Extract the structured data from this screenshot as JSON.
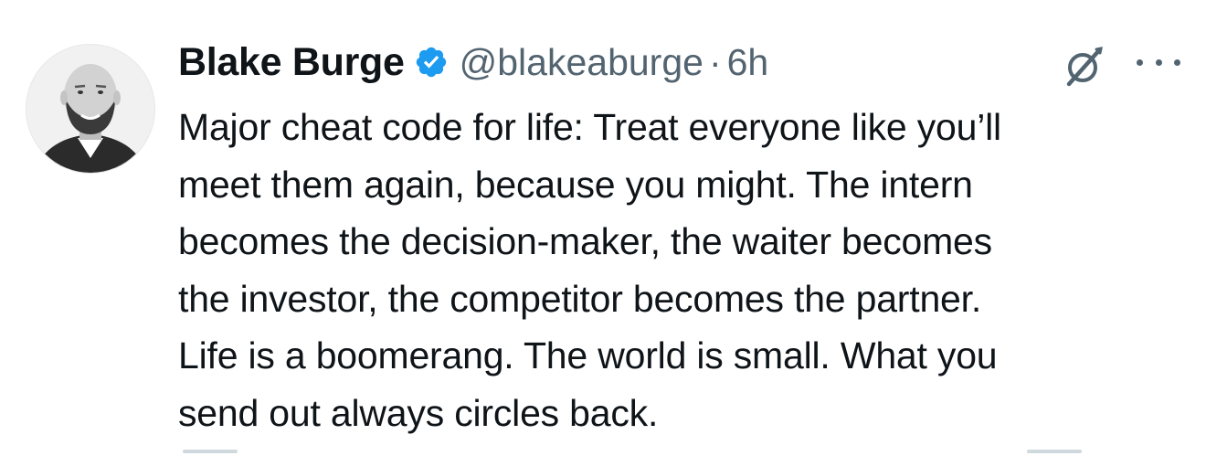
{
  "author": {
    "name": "Blake Burge",
    "handle": "@blakeaburge",
    "separator": "·",
    "time": "6h",
    "verified": true
  },
  "tweet": {
    "text": "Major cheat code for life: Treat everyone like you’ll\nmeet them again, because you might. The intern\nbecomes the decision-maker, the waiter becomes\nthe investor, the competitor becomes the partner.\nLife is a boomerang. The world is small. What you\nsend out always circles back."
  },
  "icons": {
    "verified": "verified-badge-icon",
    "grok": "grok-icon",
    "more": "more-icon"
  },
  "colors": {
    "text": "#0f1419",
    "secondary": "#536471",
    "verified": "#1d9bf0"
  }
}
